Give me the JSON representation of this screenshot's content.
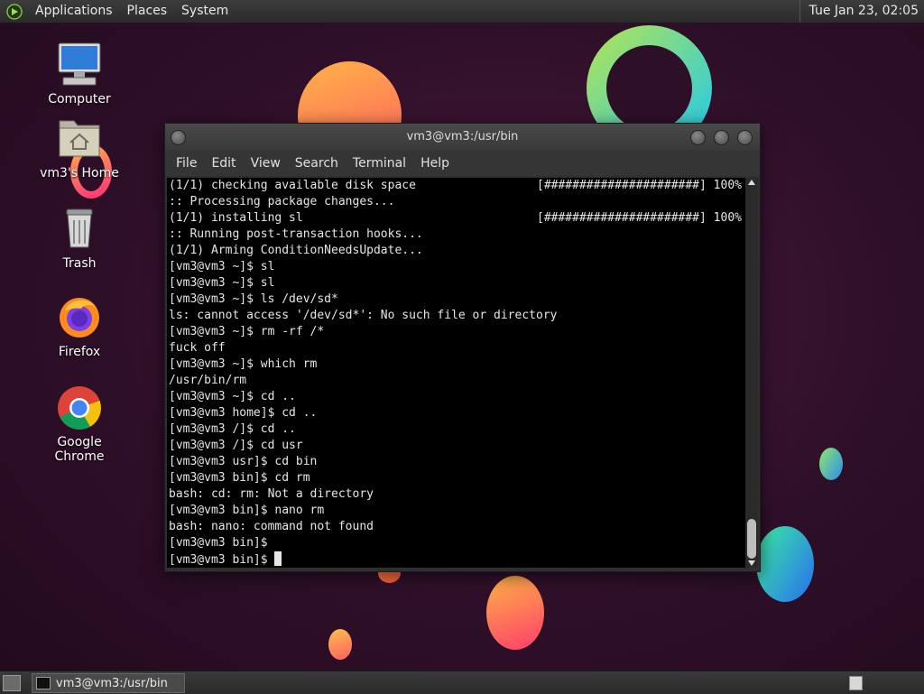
{
  "top_panel": {
    "menus": [
      "Applications",
      "Places",
      "System"
    ],
    "clock": "Tue Jan 23, 02:05"
  },
  "desktop_icons": [
    {
      "label": "Computer",
      "icon": "computer-icon"
    },
    {
      "label": "vm3's Home",
      "icon": "home-folder-icon"
    },
    {
      "label": "Trash",
      "icon": "trash-icon"
    },
    {
      "label": "Firefox",
      "icon": "firefox-icon"
    },
    {
      "label": "Google Chrome",
      "icon": "chrome-icon"
    }
  ],
  "terminal": {
    "title": "vm3@vm3:/usr/bin",
    "menu": [
      "File",
      "Edit",
      "View",
      "Search",
      "Terminal",
      "Help"
    ],
    "lines": [
      {
        "text": "(1/1) checking available disk space",
        "progress": "[######################] 100%"
      },
      {
        "text": ":: Processing package changes..."
      },
      {
        "text": "(1/1) installing sl",
        "progress": "[######################] 100%"
      },
      {
        "text": ":: Running post-transaction hooks..."
      },
      {
        "text": "(1/1) Arming ConditionNeedsUpdate..."
      },
      {
        "text": "[vm3@vm3 ~]$ sl"
      },
      {
        "text": "[vm3@vm3 ~]$ sl"
      },
      {
        "text": "[vm3@vm3 ~]$ ls /dev/sd*"
      },
      {
        "text": "ls: cannot access '/dev/sd*': No such file or directory"
      },
      {
        "text": "[vm3@vm3 ~]$ rm -rf /*"
      },
      {
        "text": "fuck off"
      },
      {
        "text": "[vm3@vm3 ~]$ which rm"
      },
      {
        "text": "/usr/bin/rm"
      },
      {
        "text": "[vm3@vm3 ~]$ cd .."
      },
      {
        "text": "[vm3@vm3 home]$ cd .."
      },
      {
        "text": "[vm3@vm3 /]$ cd .."
      },
      {
        "text": "[vm3@vm3 /]$ cd usr"
      },
      {
        "text": "[vm3@vm3 usr]$ cd bin"
      },
      {
        "text": "[vm3@vm3 bin]$ cd rm"
      },
      {
        "text": "bash: cd: rm: Not a directory"
      },
      {
        "text": "[vm3@vm3 bin]$ nano rm"
      },
      {
        "text": "bash: nano: command not found"
      },
      {
        "text": "[vm3@vm3 bin]$"
      },
      {
        "text": "[vm3@vm3 bin]$ "
      }
    ]
  },
  "taskbar": {
    "window_button": "vm3@vm3:/usr/bin"
  }
}
